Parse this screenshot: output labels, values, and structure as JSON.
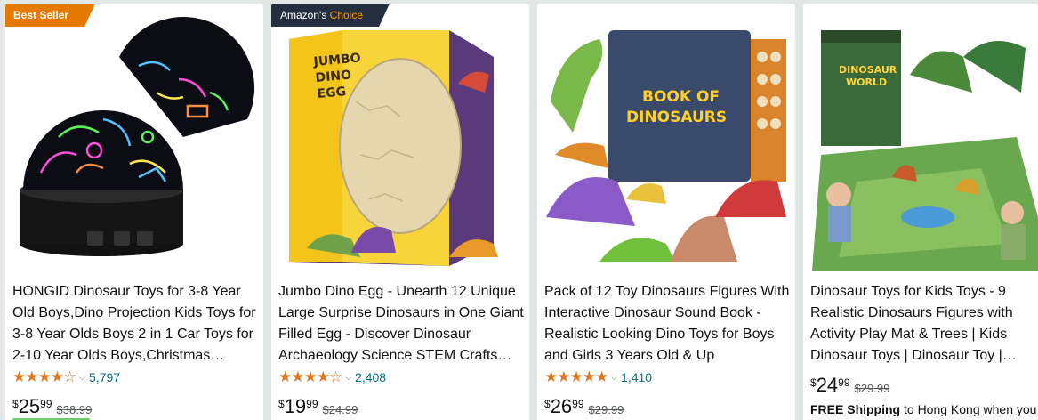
{
  "products": [
    {
      "badge": "Best Seller",
      "title": "HONGID Dinosaur Toys for 3-8 Year Old Boys,Dino Projection Kids Toys for 3-8 Year Olds Boys 2 in 1 Car Toys for 2-10 Year Olds Boys,Christmas…",
      "stars": "★★★★☆",
      "rating": 4.5,
      "review_count": "5,797",
      "currency": "$",
      "price_whole": "25",
      "price_fraction": "99",
      "list_price": "$38.99"
    },
    {
      "badge_prefix": "Amazon's",
      "badge_suffix": "Choice",
      "title": "Jumbo Dino Egg - Unearth 12 Unique Large Surprise Dinosaurs in One Giant Filled Egg - Discover Dinosaur Archaeology Science STEM Crafts…",
      "stars": "★★★★☆",
      "rating": 4.5,
      "review_count": "2,408",
      "currency": "$",
      "price_whole": "19",
      "price_fraction": "99",
      "list_price": "$24.99"
    },
    {
      "title": "Pack of 12 Toy Dinosaurs Figures With Interactive Dinosaur Sound Book - Realistic Looking Dino Toys for Boys and Girls 3 Years Old & Up",
      "stars": "★★★★★",
      "rating": 4.5,
      "review_count": "1,410",
      "currency": "$",
      "price_whole": "26",
      "price_fraction": "99",
      "list_price": "$29.99"
    },
    {
      "title": "Dinosaur Toys for Kids Toys - 9 Realistic Dinosaurs Figures with Activity Play Mat & Trees | Kids Dinosaur Toys | Dinosaur Toy |…",
      "currency": "$",
      "price_whole": "24",
      "price_fraction": "99",
      "list_price": "$29.99",
      "shipping_bold": "FREE Shipping",
      "shipping_rest": " to Hong Kong when you"
    }
  ],
  "image_art": {
    "book_title_line1": "BOOK OF",
    "book_title_line2": "DINOSAURS",
    "egg_box_line1": "JUMBO",
    "egg_box_line2": "DINO",
    "egg_box_line3": "EGG",
    "playmat_box_line1": "DINOSAUR",
    "playmat_box_line2": "WORLD"
  },
  "colors": {
    "best_seller": "#e67a00",
    "choice_bg": "#232f3e",
    "choice_accent": "#ff9900",
    "star": "#de7921",
    "link": "#007185"
  }
}
